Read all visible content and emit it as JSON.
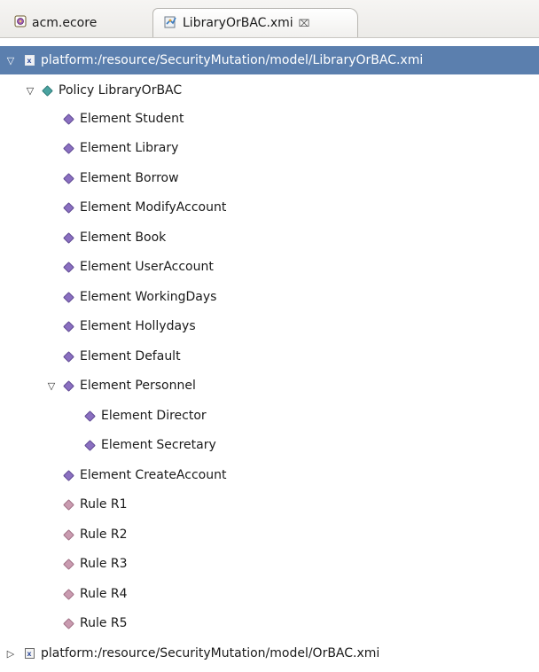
{
  "tabs": [
    {
      "label": "acm.ecore",
      "icon": "ecore-file-icon",
      "active": false
    },
    {
      "label": "LibraryOrBAC.xmi",
      "icon": "xmi-editor-icon",
      "active": true,
      "close": "⌧"
    }
  ],
  "colors": {
    "selection": "#5b7fae",
    "policy": "#4aa3a0",
    "element": "#8a6fc0",
    "rule": "#c99bb0"
  },
  "tree": {
    "resource1": {
      "label": "platform:/resource/SecurityMutation/model/LibraryOrBAC.xmi",
      "expanded": true,
      "selected": true
    },
    "policy": {
      "label": "Policy LibraryOrBAC",
      "expanded": true
    },
    "items": [
      "Element Student",
      "Element Library",
      "Element Borrow",
      "Element ModifyAccount",
      "Element Book",
      "Element UserAccount",
      "Element WorkingDays",
      "Element Hollydays",
      "Element Default",
      "Element Personnel",
      "Element Director",
      "Element Secretary",
      "Element CreateAccount",
      "Rule R1",
      "Rule R2",
      "Rule R3",
      "Rule R4",
      "Rule R5"
    ],
    "resource2": {
      "label": "platform:/resource/SecurityMutation/model/OrBAC.xmi",
      "expanded": false
    }
  }
}
